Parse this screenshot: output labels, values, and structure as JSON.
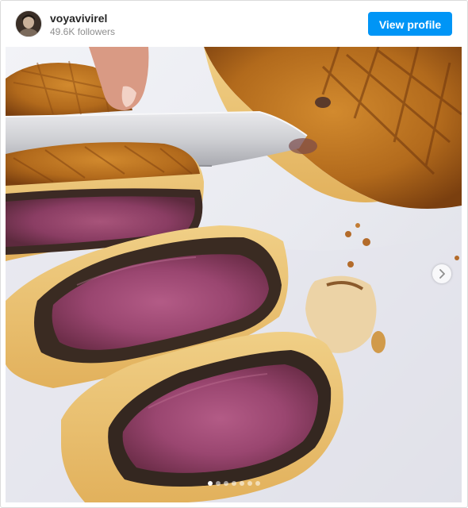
{
  "post": {
    "username": "voyavivirel",
    "followers": "49.6K followers",
    "view_profile_label": "View profile"
  },
  "carousel": {
    "current_slide": 1,
    "total_slides": 7
  },
  "icons": {
    "next": "chevron-right-icon"
  },
  "colors": {
    "button": "#0095f6",
    "username": "#262626",
    "muted": "#8e8e8e"
  }
}
